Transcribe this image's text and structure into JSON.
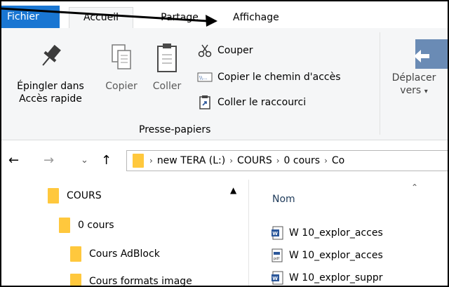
{
  "tabs": {
    "file": "Fichier",
    "home": "Accueil",
    "share": "Partage",
    "view": "Affichage"
  },
  "ribbon": {
    "pin_line1": "Épingler dans",
    "pin_line2": "Accès rapide",
    "copy": "Copier",
    "paste": "Coller",
    "cut": "Couper",
    "copy_path": "Copier le chemin d'accès",
    "paste_shortcut": "Coller le raccourci",
    "group_label": "Presse-papiers",
    "move_line1": "Déplacer",
    "move_line2": "vers",
    "move_arrow": "▾"
  },
  "address": {
    "segments": [
      "new TERA (L:)",
      "COURS",
      "0 cours",
      "Co"
    ]
  },
  "tree": {
    "items": [
      {
        "label": "COURS"
      },
      {
        "label": "0 cours"
      },
      {
        "label": "Cours AdBlock"
      },
      {
        "label": "Cours formats image"
      }
    ]
  },
  "files": {
    "column_name": "Nom",
    "rows": [
      {
        "name": "W 10_explor_acces",
        "type": "word"
      },
      {
        "name": "W 10_explor_acces",
        "type": "pdf"
      },
      {
        "name": "W 10_explor_suppr",
        "type": "word"
      }
    ]
  },
  "colors": {
    "file_tab": "#1976d2",
    "ribbon_bg": "#f5f6f7",
    "folder": "#ffc83d",
    "word_blue": "#2b579a"
  }
}
